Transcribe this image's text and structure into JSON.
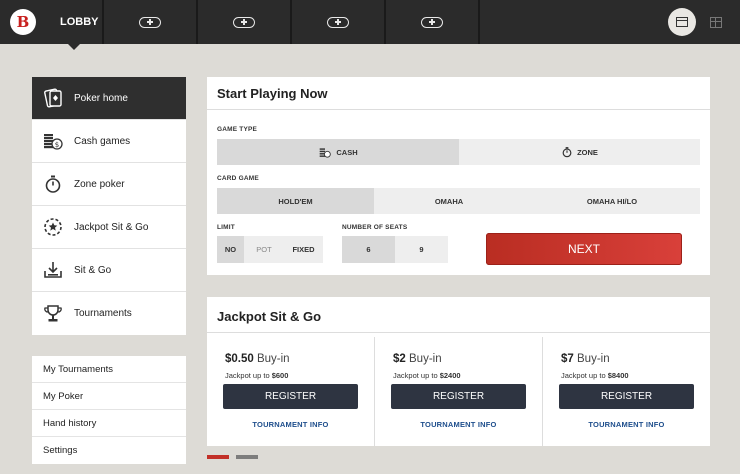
{
  "header": {
    "logo_letter": "B",
    "lobby_label": "LOBBY",
    "table_slots": [
      "add-table",
      "add-table",
      "add-table",
      "add-table"
    ],
    "view_modes": [
      "single-table-view",
      "grid-view"
    ]
  },
  "nav": {
    "items": [
      {
        "label": "Poker home",
        "icon": "cards-icon",
        "active": true
      },
      {
        "label": "Cash games",
        "icon": "chips-icon"
      },
      {
        "label": "Zone poker",
        "icon": "stopwatch-icon"
      },
      {
        "label": "Jackpot Sit & Go",
        "icon": "jackpot-chip-icon"
      },
      {
        "label": "Sit & Go",
        "icon": "download-tray-icon"
      },
      {
        "label": "Tournaments",
        "icon": "trophy-icon"
      }
    ],
    "links": [
      "My Tournaments",
      "My Poker",
      "Hand history",
      "Settings"
    ]
  },
  "start": {
    "title": "Start Playing Now",
    "game_type_label": "GAME TYPE",
    "game_types": [
      "CASH",
      "ZONE"
    ],
    "game_type_selected": "CASH",
    "card_game_label": "CARD GAME",
    "card_games": [
      "HOLD'EM",
      "OMAHA",
      "OMAHA HI/LO"
    ],
    "card_game_selected": "HOLD'EM",
    "limit_label": "LIMIT",
    "limits": [
      "NO",
      "POT",
      "FIXED"
    ],
    "seats_label": "NUMBER OF SEATS",
    "seats": [
      "6",
      "9"
    ],
    "seats_selected": "6",
    "next_label": "NEXT"
  },
  "jackpot": {
    "title": "Jackpot Sit & Go",
    "buyin_suffix": "Buy-in",
    "jackpot_prefix": "Jackpot up to",
    "register_label": "REGISTER",
    "info_label": "TOURNAMENT INFO",
    "games": [
      {
        "buyin": "$0.50",
        "jackpot": "$600"
      },
      {
        "buyin": "$2",
        "jackpot": "$2400"
      },
      {
        "buyin": "$7",
        "jackpot": "$8400"
      }
    ],
    "pager": {
      "pages": 2,
      "current": 1
    }
  },
  "colors": {
    "accent": "#c23028",
    "dark": "#2b2b2b",
    "button": "#2e3441",
    "link": "#1e4e8c"
  }
}
